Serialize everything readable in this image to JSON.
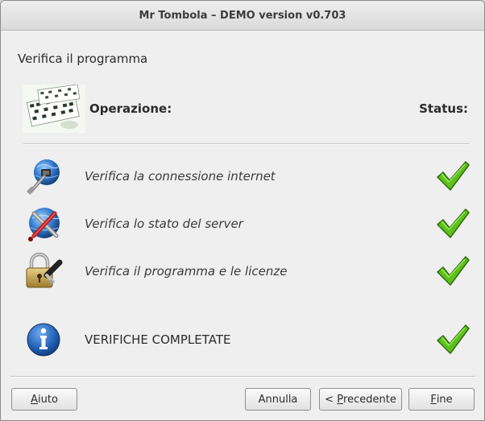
{
  "window": {
    "title": "Mr Tombola – DEMO version v0.703"
  },
  "page": {
    "heading": "Verifica il programma"
  },
  "header": {
    "operation_label": "Operazione:",
    "status_label": "Status:"
  },
  "checks": [
    {
      "icon": "globe-network-icon",
      "label": "Verifica la connessione internet",
      "status": "ok"
    },
    {
      "icon": "globe-tools-icon",
      "label": "Verifica lo stato del server",
      "status": "ok"
    },
    {
      "icon": "padlock-key-icon",
      "label": "Verifica il programma e le licenze",
      "status": "ok"
    }
  ],
  "summary": {
    "icon": "info-icon",
    "label": "VERIFICHE COMPLETATE",
    "status": "ok"
  },
  "buttons": {
    "help": {
      "mnemonic": "A",
      "rest": "iuto"
    },
    "cancel": {
      "label": "Annulla"
    },
    "previous": {
      "prefix": "< ",
      "mnemonic": "P",
      "rest": "recedente"
    },
    "finish": {
      "mnemonic": "F",
      "rest": "ine"
    }
  },
  "colors": {
    "check_green": "#5cc21a",
    "info_blue": "#1f5fb3"
  }
}
